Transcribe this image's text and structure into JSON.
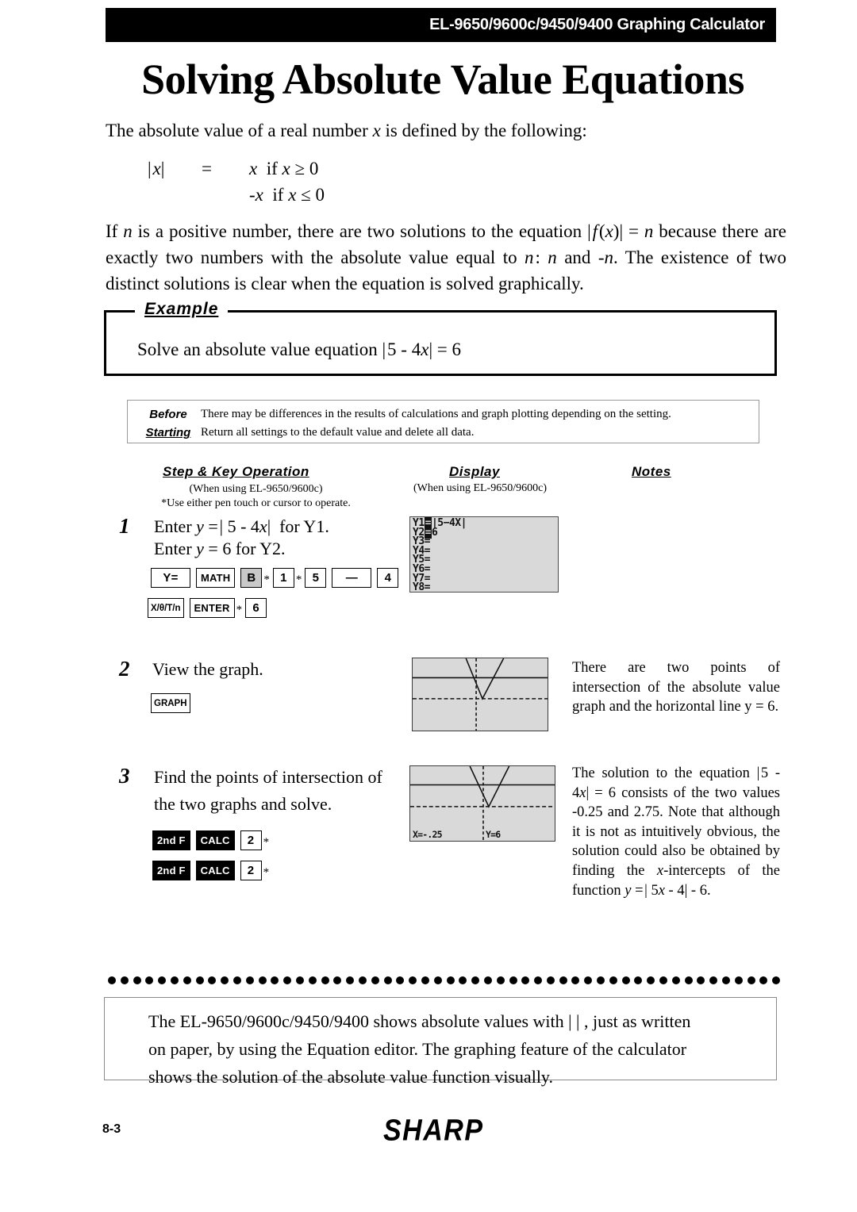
{
  "header": {
    "title": "EL-9650/9600c/9450/9400 Graphing Calculator"
  },
  "page_title": "Solving Absolute Value Equations",
  "intro": {
    "paragraph1": "The absolute value of a real number x is defined by the following:",
    "definition": {
      "lhs": "| x |",
      "equals": "=",
      "case1": "x  if x ≥ 0",
      "case2": "-x  if x ≤ 0"
    },
    "paragraph2": "If n is a positive number, there are two solutions to the equation | f (x) | = n because there are exactly two numbers with the absolute value equal to n : n and -n. The existence of two distinct solutions is clear when the equation is solved graphically."
  },
  "example": {
    "legend": "Example",
    "text": "Solve an absolute value equation | 5 - 4x | = 6"
  },
  "before_starting": {
    "label_line1": "Before",
    "label_line2": "Starting",
    "text_line1": "There may be differences in the results of calculations and graph plotting depending on the setting.",
    "text_line2": "Return all settings to the default value and delete all data."
  },
  "columns": {
    "step_header": "Step & Key Operation",
    "step_sub1": "(When using EL-9650/9600c)",
    "step_sub2": "*Use either pen touch or cursor to operate.",
    "display_header": "Display",
    "display_sub": "(When using EL-9650/9600c)",
    "notes_header": "Notes"
  },
  "steps": [
    {
      "number": "1",
      "text_line1": "Enter y = | 5 - 4x |  for Y1.",
      "text_line2": "Enter y = 6 for Y2.",
      "keys_row1": [
        {
          "label": "Y=",
          "style": "outline",
          "star": false
        },
        {
          "label": "MATH",
          "style": "outline",
          "star": false
        },
        {
          "label": "B",
          "style": "gray",
          "star": true
        },
        {
          "label": "1",
          "style": "outline",
          "star": true
        },
        {
          "label": "5",
          "style": "outline",
          "star": false
        },
        {
          "label": "—",
          "style": "outline",
          "star": false
        },
        {
          "label": "4",
          "style": "outline",
          "star": false
        }
      ],
      "keys_row2": [
        {
          "label": "X/θ/T/n",
          "style": "outline",
          "star": false
        },
        {
          "label": "ENTER",
          "style": "outline",
          "star": true
        },
        {
          "label": "6",
          "style": "outline",
          "star": false
        }
      ],
      "display": {
        "type": "y-editor",
        "lines": [
          {
            "label": "Y1",
            "marker": "=",
            "value": "|5−4X|"
          },
          {
            "label": "Y2",
            "marker": "=",
            "value": "6"
          },
          {
            "label": "Y3",
            "marker": "=",
            "value": ""
          },
          {
            "label": "Y4",
            "marker": "=",
            "value": ""
          },
          {
            "label": "Y5",
            "marker": "=",
            "value": ""
          },
          {
            "label": "Y6",
            "marker": "=",
            "value": ""
          },
          {
            "label": "Y7",
            "marker": "=",
            "value": ""
          },
          {
            "label": "Y8",
            "marker": "=",
            "value": ""
          }
        ]
      },
      "note": ""
    },
    {
      "number": "2",
      "text_line1": "View the graph.",
      "text_line2": "",
      "keys_row1": [
        {
          "label": "GRAPH",
          "style": "outline",
          "star": false
        }
      ],
      "keys_row2": [],
      "display": {
        "type": "graph",
        "readout_x": "",
        "readout_y": ""
      },
      "note": "There are two points of intersection of the absolute value graph and the horizontal line y = 6."
    },
    {
      "number": "3",
      "text_line1": "Find the points of intersection of",
      "text_line2": "the two graphs and solve.",
      "keys_row1": [
        {
          "label": "2nd F",
          "style": "inverse",
          "star": false
        },
        {
          "label": "CALC",
          "style": "inverse",
          "star": false
        },
        {
          "label": "2",
          "style": "outline",
          "star": true
        }
      ],
      "keys_row2": [
        {
          "label": "2nd F",
          "style": "inverse",
          "star": false
        },
        {
          "label": "CALC",
          "style": "inverse",
          "star": false
        },
        {
          "label": "2",
          "style": "outline",
          "star": true
        }
      ],
      "display": {
        "type": "graph",
        "readout_x": "X=-.25",
        "readout_y": "Y=6"
      },
      "note": "The solution to the equation | 5 - 4x | = 6 consists of the two values -0.25 and 2.75. Note that although it is not as intuitively obvious, the solution could also be obtained by finding the x-intercepts of the function y = | 5x - 4 | - 6."
    }
  ],
  "bottom_note": {
    "line1": "The EL-9650/9600c/9450/9400 shows absolute values with |   | , just as written",
    "line2": "on paper, by using the Equation editor. The graphing feature of the calculator",
    "line3": "shows the solution of the absolute value function visually."
  },
  "footer": {
    "page_number": "8-3",
    "brand": "SHARP"
  },
  "colors": {
    "header_bg": "#000000",
    "lcd_bg": "#d9d9d9",
    "lcd_border": "#3a3a3a",
    "gray_key": "#c9c9c9"
  }
}
